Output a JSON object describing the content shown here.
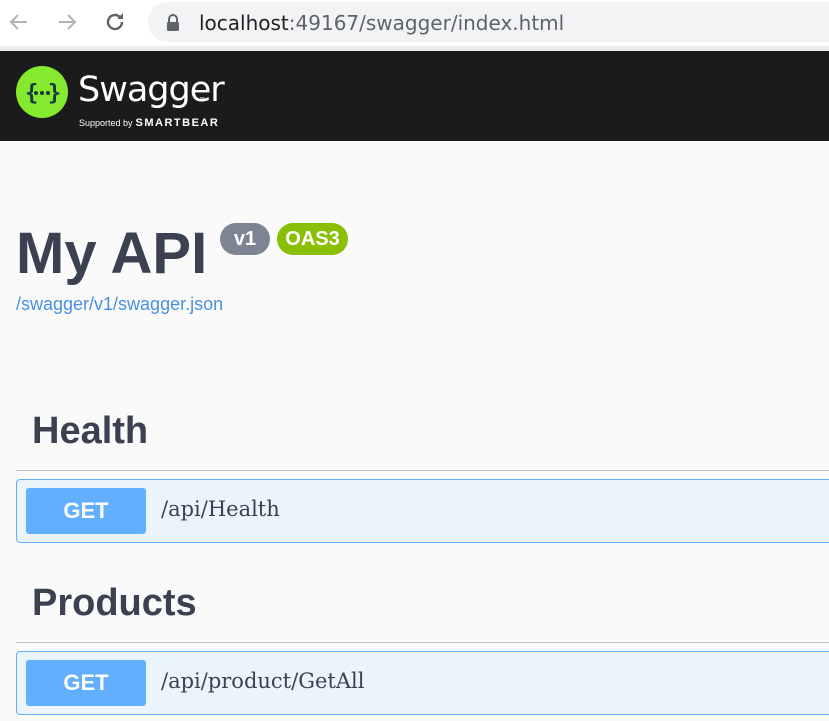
{
  "browser": {
    "url_host": "localhost",
    "url_path": ":49167/swagger/index.html",
    "icons": [
      "back-arrow-icon",
      "forward-arrow-icon",
      "reload-icon",
      "lock-icon"
    ]
  },
  "topbar": {
    "brand": "Swagger",
    "trademark": "™",
    "supported_by": "Supported by",
    "company": "SMARTBEAR",
    "logo_icon": "swagger-braces-icon",
    "colors": {
      "background": "#1b1b1b",
      "logo": "#85ea2d"
    }
  },
  "info": {
    "title": "My API",
    "version": "v1",
    "oas": "OAS3",
    "spec_url": "/swagger/v1/swagger.json",
    "colors": {
      "version_badge": "#7d8492",
      "oas_badge": "#89bf04",
      "link": "#4990e2"
    }
  },
  "tags": [
    {
      "name": "Health",
      "operations": [
        {
          "method": "GET",
          "path": "/api/Health"
        }
      ]
    },
    {
      "name": "Products",
      "operations": [
        {
          "method": "GET",
          "path": "/api/product/GetAll"
        }
      ]
    }
  ],
  "colors": {
    "get": "#61affe",
    "get_bg": "#ebf3fb"
  }
}
